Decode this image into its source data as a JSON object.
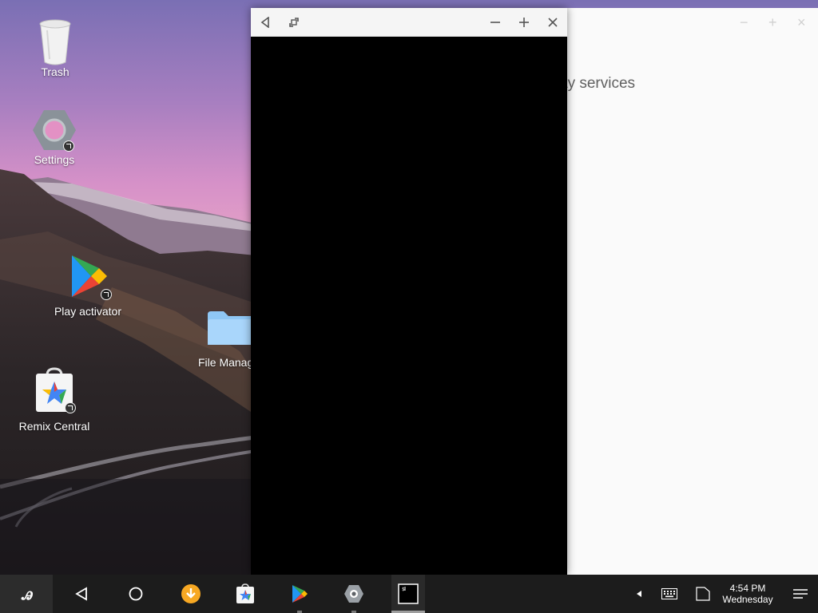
{
  "desktop": {
    "icons": [
      {
        "label": "Trash",
        "icon": "trash-icon"
      },
      {
        "label": "Settings",
        "icon": "settings-gear-icon"
      },
      {
        "label": "Play activator",
        "icon": "play-store-icon"
      },
      {
        "label": "File Manag",
        "icon": "folder-icon"
      },
      {
        "label": "Remix Central",
        "icon": "remix-central-store-icon"
      }
    ]
  },
  "background_window": {
    "visible_text": "ay services",
    "controls": [
      "minimize-icon",
      "maximize-icon",
      "close-icon"
    ]
  },
  "foreground_window": {
    "controls": [
      "back-icon",
      "resize-icon",
      "minimize-icon",
      "maximize-icon",
      "close-icon"
    ]
  },
  "taskbar": {
    "start_glyph": "ꭿ",
    "nav": [
      "back-icon",
      "home-icon"
    ],
    "apps": [
      "download-app-icon",
      "remix-central-store-icon",
      "play-store-icon",
      "settings-gear-icon",
      "terminal-icon"
    ],
    "tray": [
      "tray-expand-icon",
      "keyboard-icon",
      "signal-icon"
    ],
    "clock": {
      "time": "4:54 PM",
      "day": "Wednesday"
    },
    "menu_icon": "notifications-menu-icon"
  },
  "colors": {
    "taskbar_bg": "#1c1c1c",
    "window_titlebar": "#f5f5f5",
    "app_content": "#000000",
    "download_orange": "#f7a823"
  }
}
